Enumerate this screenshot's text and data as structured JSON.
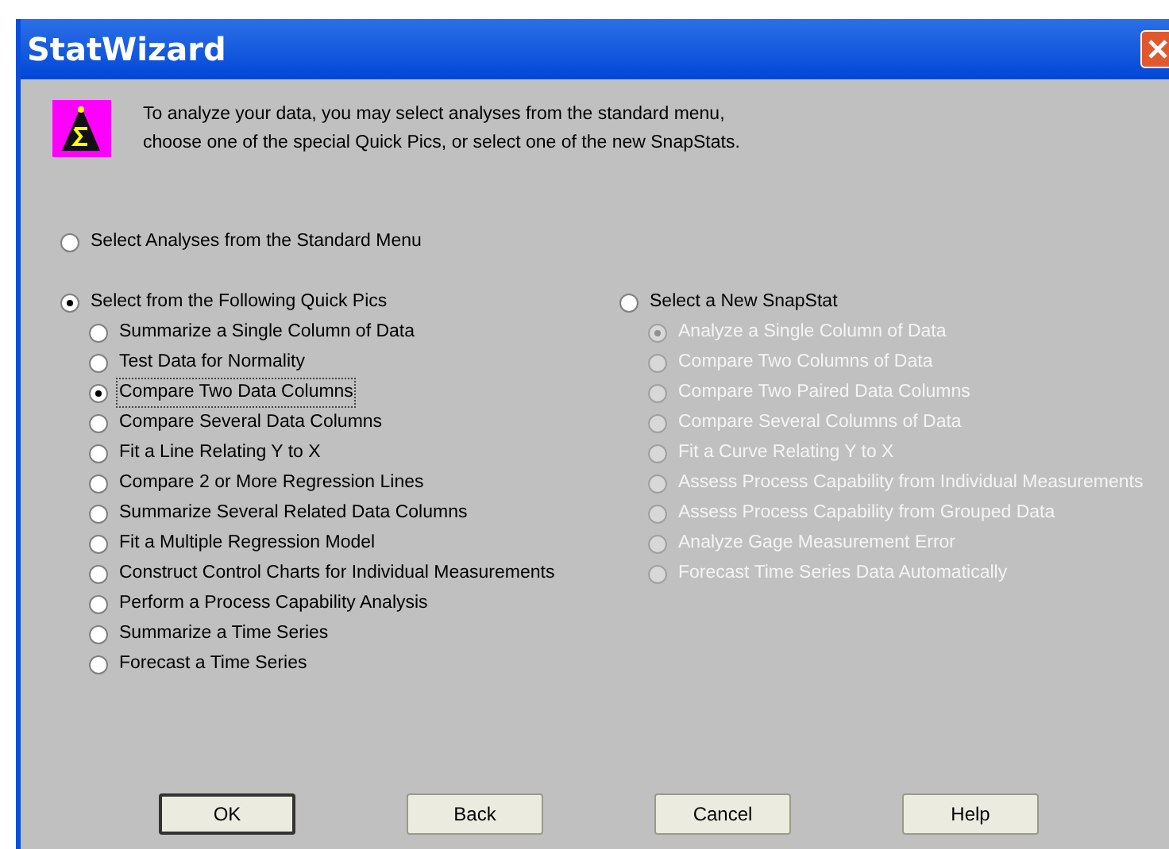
{
  "window": {
    "title": "StatWizard"
  },
  "intro": {
    "lines": [
      "To analyze your data, you may select analyses from the standard menu,",
      "choose one of the special Quick Pics, or select one of the new SnapStats."
    ]
  },
  "standard": {
    "label": "Select Analyses from the Standard Menu",
    "selected": false
  },
  "quick_pics": {
    "label": "Select from the Following Quick Pics",
    "selected": true,
    "items": [
      {
        "label": "Summarize a Single Column of Data",
        "selected": false
      },
      {
        "label": "Test Data for Normality",
        "selected": false
      },
      {
        "label": "Compare Two Data Columns",
        "selected": true
      },
      {
        "label": "Compare Several Data Columns",
        "selected": false
      },
      {
        "label": "Fit a Line Relating Y to X",
        "selected": false
      },
      {
        "label": "Compare 2 or More Regression Lines",
        "selected": false
      },
      {
        "label": "Summarize Several Related Data Columns",
        "selected": false
      },
      {
        "label": "Fit a Multiple Regression Model",
        "selected": false
      },
      {
        "label": "Construct Control Charts for Individual Measurements",
        "selected": false
      },
      {
        "label": "Perform a Process Capability Analysis",
        "selected": false
      },
      {
        "label": "Summarize a Time Series",
        "selected": false
      },
      {
        "label": "Forecast a Time Series",
        "selected": false
      }
    ]
  },
  "snapstat": {
    "label": "Select a New SnapStat",
    "selected": false,
    "items": [
      {
        "label": "Analyze a Single Column of Data",
        "selected": true,
        "disabled": true
      },
      {
        "label": "Compare Two Columns of Data",
        "selected": false,
        "disabled": true
      },
      {
        "label": "Compare Two Paired Data Columns",
        "selected": false,
        "disabled": true
      },
      {
        "label": "Compare Several Columns of Data",
        "selected": false,
        "disabled": true
      },
      {
        "label": "Fit a Curve Relating Y to X",
        "selected": false,
        "disabled": true
      },
      {
        "label": "Assess Process Capability from Individual Measurements",
        "selected": false,
        "disabled": true
      },
      {
        "label": "Assess Process Capability from Grouped Data",
        "selected": false,
        "disabled": true
      },
      {
        "label": "Analyze Gage Measurement Error",
        "selected": false,
        "disabled": true
      },
      {
        "label": "Forecast Time Series Data Automatically",
        "selected": false,
        "disabled": true
      }
    ]
  },
  "buttons": [
    {
      "label": "OK",
      "default": true
    },
    {
      "label": "Back",
      "default": false
    },
    {
      "label": "Cancel",
      "default": false
    },
    {
      "label": "Help",
      "default": false
    }
  ]
}
